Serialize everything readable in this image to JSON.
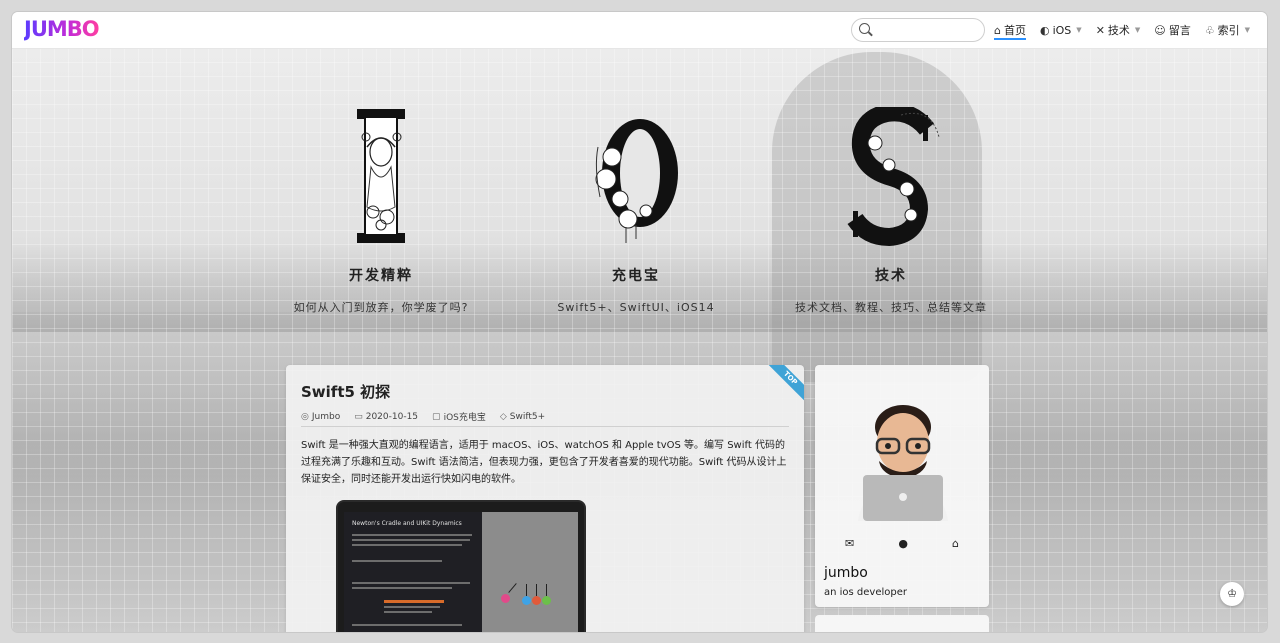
{
  "header": {
    "logo": "JUMBO",
    "search": {
      "value": "",
      "placeholder": ""
    },
    "nav": [
      {
        "label": "首页",
        "icon": "home-icon",
        "active": true
      },
      {
        "label": "iOS",
        "icon": "apple-icon",
        "dropdown": true
      },
      {
        "label": "技术",
        "icon": "tools-icon",
        "dropdown": true
      },
      {
        "label": "留言",
        "icon": "message-icon"
      },
      {
        "label": "索引",
        "icon": "index-icon",
        "dropdown": true
      }
    ]
  },
  "hero": [
    {
      "letter": "I",
      "title": "开发精粹",
      "subtitle": "如何从入门到放弃，你学废了吗?"
    },
    {
      "letter": "O",
      "title": "充电宝",
      "subtitle": "Swift5+、SwiftUI、iOS14"
    },
    {
      "letter": "S",
      "title": "技术",
      "subtitle": "技术文档、教程、技巧、总结等文章"
    }
  ],
  "post": {
    "ribbon": "TOP",
    "title": "Swift5 初探",
    "author": "Jumbo",
    "date": "2020-10-15",
    "category": "iOS充电宝",
    "tag": "Swift5+",
    "excerpt": "Swift 是一种强大直观的编程语言，适用于 macOS、iOS、watchOS 和 Apple tvOS 等。编写 Swift 代码的过程充满了乐趣和互动。Swift 语法简洁，但表现力强，更包含了开发者喜爱的现代功能。Swift 代码从设计上保证安全，同时还能开发出运行快如闪电的软件。",
    "image_heading": "Newton's Cradle and UIKit Dynamics"
  },
  "profile": {
    "name": "jumbo",
    "description": "an ios developer",
    "links": [
      "mail-icon",
      "github-icon",
      "home-icon"
    ]
  },
  "sidebar_next": {
    "title": ""
  },
  "colors": {
    "accent": "#2b91ff",
    "ribbon": "#3fa3d6"
  }
}
